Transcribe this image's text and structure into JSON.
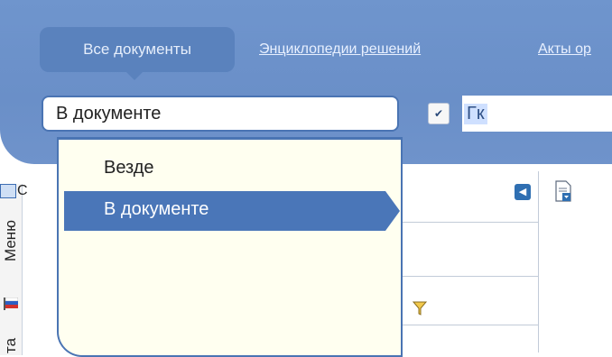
{
  "search_panel": {
    "tabs": {
      "active": "Все документы",
      "links": [
        "Энциклопедии решений",
        "Акты ор"
      ]
    },
    "scope_select": {
      "value": "В документе"
    },
    "query": {
      "value": "Гк"
    }
  },
  "dropdown": {
    "options": [
      "Везде",
      "В документе"
    ],
    "selected": "В документе"
  },
  "sidebar": {
    "vertical_labels": {
      "menu": "Меню",
      "partial": "та"
    },
    "partial_tab_letter": "С"
  },
  "colors": {
    "panel_blue": "#6a8fc8",
    "active_tab": "#5a82bd",
    "dropdown_bg": "#fffff0",
    "highlight": "#4a76b8"
  },
  "icons": [
    "toc-icon",
    "flag-icon",
    "collapse-icon",
    "document-icon",
    "filter-icon",
    "chevron-down-icon"
  ]
}
